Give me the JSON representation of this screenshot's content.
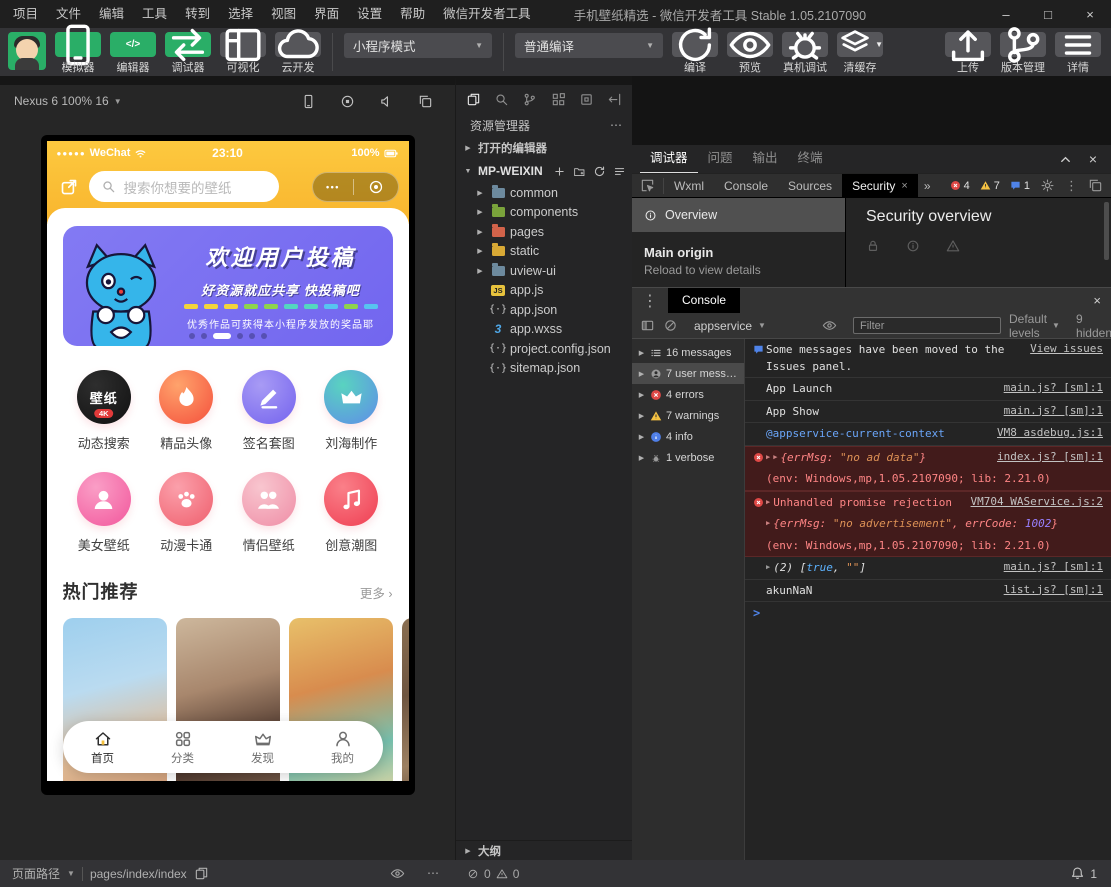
{
  "colors": {
    "wechat_green": "#2aae67",
    "header_yellow": "#f8b52e",
    "banner_purple": "#7266ef",
    "error_red": "#df4846",
    "warning_yellow": "#f5c242",
    "info_blue": "#4f7fe8"
  },
  "titlebar": {
    "menus": [
      "项目",
      "文件",
      "编辑",
      "工具",
      "转到",
      "选择",
      "视图",
      "界面",
      "设置",
      "帮助",
      "微信开发者工具"
    ],
    "title": "手机壁纸精选 - 微信开发者工具 Stable 1.05.2107090",
    "minimize": "–",
    "maximize": "□",
    "close": "×"
  },
  "toolbar": {
    "tools": [
      {
        "label": "模拟器",
        "icon": "phone",
        "variant": "green"
      },
      {
        "label": "编辑器",
        "icon": "code",
        "variant": "green"
      },
      {
        "label": "调试器",
        "icon": "swap",
        "variant": "green"
      },
      {
        "label": "可视化",
        "icon": "layout",
        "variant": "gray"
      },
      {
        "label": "云开发",
        "icon": "cloud",
        "variant": "gray"
      }
    ],
    "mode_select": "小程序模式",
    "compile_select": "普通编译",
    "actions": [
      {
        "label": "编译",
        "icon": "refresh",
        "caret": false
      },
      {
        "label": "预览",
        "icon": "eye",
        "caret": false
      },
      {
        "label": "真机调试",
        "icon": "bug",
        "caret": false
      },
      {
        "label": "清缓存",
        "icon": "layers",
        "caret": true
      }
    ],
    "right_actions": [
      {
        "label": "上传",
        "icon": "upload"
      },
      {
        "label": "版本管理",
        "icon": "branch"
      },
      {
        "label": "详情",
        "icon": "menu"
      }
    ]
  },
  "simulator": {
    "device": "Nexus 6 100% 16",
    "statusbar": {
      "carrier": "WeChat",
      "time": "23:10",
      "battery": "100%"
    },
    "search_placeholder": "搜索你想要的壁纸",
    "capsule_dots": "•••",
    "banner": {
      "title": "欢迎用户投稿",
      "subtitle": "好资源就应共享  快投稿吧",
      "note": "优秀作品可获得本小程序发放的奖品耶",
      "dash_colors": [
        "#f2d53c",
        "#f2d53c",
        "#f2d53c",
        "#8ed44c",
        "#8ed44c",
        "#54d6c0",
        "#54d6c0",
        "#57c4f0",
        "#8ed44c",
        "#57c4f0"
      ],
      "dots_total": 6,
      "dots_active_index": 2
    },
    "categories": [
      {
        "label": "动态搜索",
        "icon": "wallpaper",
        "c1": "#2e2e2e",
        "c2": "#111111",
        "text": "壁纸",
        "badge": "4K"
      },
      {
        "label": "精品头像",
        "icon": "flame",
        "c1": "#ffa36c",
        "c2": "#f4503c"
      },
      {
        "label": "签名套图",
        "icon": "pencil",
        "c1": "#a89bf5",
        "c2": "#7463ee"
      },
      {
        "label": "刘海制作",
        "icon": "crown",
        "c1": "#59d3c0",
        "c2": "#5f8de8"
      },
      {
        "label": "美女壁纸",
        "icon": "girl",
        "c1": "#fa9ec6",
        "c2": "#f2579c"
      },
      {
        "label": "动漫卡通",
        "icon": "paw",
        "c1": "#fba0ab",
        "c2": "#ef5f6d"
      },
      {
        "label": "情侣壁纸",
        "icon": "couple",
        "c1": "#f8c6cf",
        "c2": "#ef8da6"
      },
      {
        "label": "创意潮图",
        "icon": "music",
        "c1": "#fa8089",
        "c2": "#ef3e52"
      }
    ],
    "hot": {
      "title": "热门推荐",
      "more": "更多",
      "more_arrow": "›"
    },
    "cards": [
      {
        "colors": [
          "#9ecfee",
          "#badbf0",
          "#e2bb95",
          "#cf9a75"
        ]
      },
      {
        "colors": [
          "#cdb79c",
          "#a8876d",
          "#483229",
          "#7e6450"
        ]
      },
      {
        "colors": [
          "#e8c06a",
          "#d88c4e",
          "#76c0ae",
          "#e8d6a0"
        ]
      },
      {
        "colors": [
          "#8a6f52",
          "#6e5540",
          "#9c8062",
          "#55402f"
        ]
      }
    ],
    "tabbar": [
      {
        "label": "首页",
        "icon": "home",
        "active": true
      },
      {
        "label": "分类",
        "icon": "grid",
        "active": false
      },
      {
        "label": "发现",
        "icon": "crown2",
        "active": false
      },
      {
        "label": "我的",
        "icon": "person",
        "active": false
      }
    ]
  },
  "explorer": {
    "title": "资源管理器",
    "open_editors": "打开的编辑器",
    "project": "MP-WEIXIN",
    "tree": [
      {
        "name": "common",
        "kind": "folder",
        "color": "#6d8a9e"
      },
      {
        "name": "components",
        "kind": "folder",
        "color": "#7aa33b"
      },
      {
        "name": "pages",
        "kind": "folder",
        "color": "#d2634a"
      },
      {
        "name": "static",
        "kind": "folder",
        "color": "#d8a935"
      },
      {
        "name": "uview-ui",
        "kind": "folder",
        "color": "#6d8a9e"
      },
      {
        "name": "app.js",
        "kind": "js"
      },
      {
        "name": "app.json",
        "kind": "json"
      },
      {
        "name": "app.wxss",
        "kind": "wxss"
      },
      {
        "name": "project.config.json",
        "kind": "json"
      },
      {
        "name": "sitemap.json",
        "kind": "json"
      }
    ],
    "outline": "大纲"
  },
  "debugger": {
    "tabs": [
      {
        "label": "调试器",
        "active": true
      },
      {
        "label": "问题",
        "active": false
      },
      {
        "label": "输出",
        "active": false
      },
      {
        "label": "终端",
        "active": false
      }
    ],
    "devtools_tabs": [
      {
        "label": "Wxml",
        "active": false
      },
      {
        "label": "Console",
        "active": false
      },
      {
        "label": "Sources",
        "active": false
      },
      {
        "label": "Security",
        "active": true
      }
    ],
    "tabs_overflow": "»",
    "badges": {
      "errors": "4",
      "warnings": "7",
      "issues": "1"
    },
    "security": {
      "sidebar_item": "Overview",
      "main_origin": "Main origin",
      "reload_hint": "Reload to view details",
      "title": "Security overview"
    },
    "console": {
      "tab": "Console",
      "context": "appservice",
      "filter_placeholder": "Filter",
      "levels": "Default levels",
      "hidden": "9 hidden",
      "prompt": ">",
      "sidebar": [
        {
          "label": "16 messages",
          "icon": "list",
          "selected": false
        },
        {
          "label": "7 user mess…",
          "icon": "user",
          "selected": true
        },
        {
          "label": "4 errors",
          "icon": "error",
          "selected": false
        },
        {
          "label": "7 warnings",
          "icon": "warning",
          "selected": false
        },
        {
          "label": "4 info",
          "icon": "info",
          "selected": false
        },
        {
          "label": "1 verbose",
          "icon": "verbose",
          "selected": false
        }
      ],
      "messages": [
        {
          "level": "issues",
          "lines": [
            {
              "seg": [
                {
                  "t": "Some messages have been moved to the Issues panel.",
                  "c": ""
                }
              ],
              "link": "View issues"
            }
          ]
        },
        {
          "level": "log",
          "lines": [
            {
              "seg": [
                {
                  "t": "App Launch",
                  "c": ""
                }
              ],
              "src": "main.js? [sm]:1"
            }
          ]
        },
        {
          "level": "log",
          "lines": [
            {
              "seg": [
                {
                  "t": "App Show",
                  "c": ""
                }
              ],
              "src": "main.js? [sm]:1"
            }
          ]
        },
        {
          "level": "log",
          "lines": [
            {
              "seg": [
                {
                  "t": "@appservice-current-context",
                  "c": "blue"
                }
              ],
              "src": "VM8 asdebug.js:1"
            }
          ]
        },
        {
          "level": "error",
          "lines": [
            {
              "arrows": 2,
              "seg": [
                {
                  "t": "{errMsg: ",
                  "c": "err it"
                },
                {
                  "t": "\"no ad data\"",
                  "c": "str it"
                },
                {
                  "t": "}",
                  "c": "err it"
                }
              ],
              "src": "index.js? [sm]:1"
            },
            {
              "seg": [
                {
                  "t": "(env: Windows,mp,1.05.2107090; lib: 2.21.0)",
                  "c": "err"
                }
              ]
            }
          ]
        },
        {
          "level": "error",
          "lines": [
            {
              "arrows": 1,
              "seg": [
                {
                  "t": "Unhandled promise rejection",
                  "c": "err"
                }
              ],
              "src": "VM704 WAService.js:2"
            },
            {
              "arrows": 1,
              "seg": [
                {
                  "t": "{errMsg: ",
                  "c": "err it"
                },
                {
                  "t": "\"no advertisement\"",
                  "c": "str it"
                },
                {
                  "t": ", errCode: ",
                  "c": "err it"
                },
                {
                  "t": "1002",
                  "c": "num it"
                },
                {
                  "t": "}",
                  "c": "err it"
                }
              ]
            },
            {
              "seg": [
                {
                  "t": "(env: Windows,mp,1.05.2107090; lib: 2.21.0)",
                  "c": "err"
                }
              ]
            }
          ]
        },
        {
          "level": "log",
          "lines": [
            {
              "arrows": 1,
              "seg": [
                {
                  "t": "(2) ",
                  "c": "it"
                },
                {
                  "t": "[",
                  "c": "it"
                },
                {
                  "t": "true",
                  "c": "bool it"
                },
                {
                  "t": ", ",
                  "c": "it"
                },
                {
                  "t": "\"\"",
                  "c": "str it"
                },
                {
                  "t": "]",
                  "c": "it"
                }
              ],
              "src": "main.js? [sm]:1"
            }
          ]
        },
        {
          "level": "log",
          "lines": [
            {
              "seg": [
                {
                  "t": "akunNaN",
                  "c": ""
                }
              ],
              "src": "list.js? [sm]:1"
            }
          ]
        }
      ]
    }
  },
  "statusbar": {
    "path_label": "页面路径",
    "path": "pages/index/index",
    "errors": "0",
    "warnings": "0",
    "notification_count": "1"
  }
}
